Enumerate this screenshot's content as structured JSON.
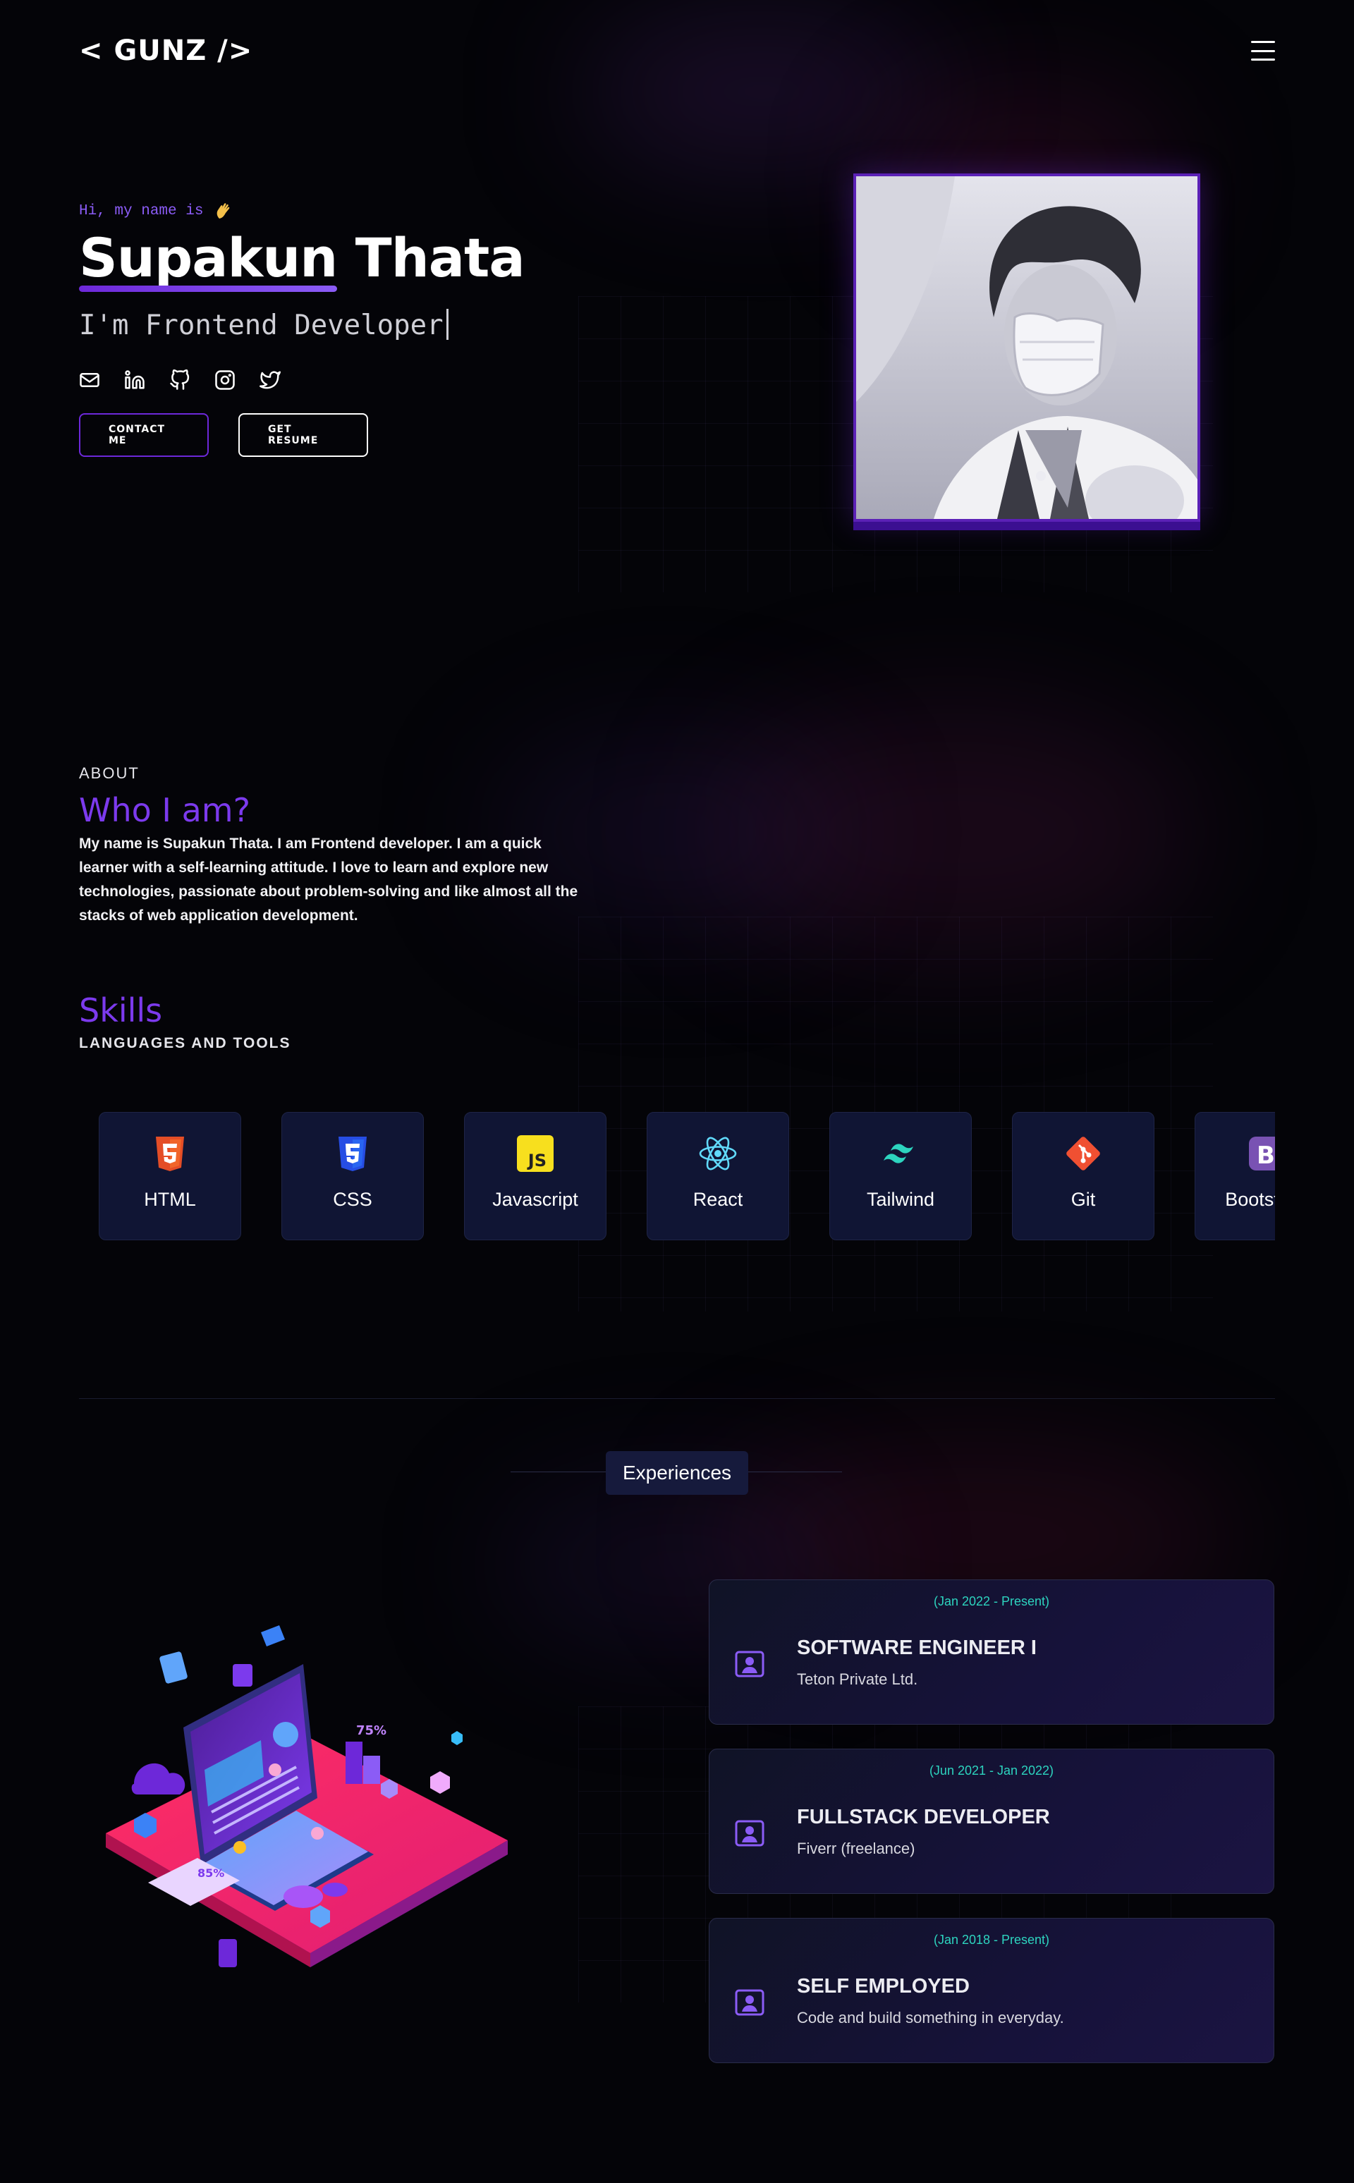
{
  "nav": {
    "logo": "< GUNZ />",
    "menu_icon": "menu-icon"
  },
  "hero": {
    "greeting": "Hi, my name is",
    "greeting_icon": "waving-hand-icon",
    "first_name": "Supakun",
    "last_name": "Thata",
    "role": "I'm Frontend Developer",
    "socials": [
      "mail-icon",
      "linkedin-icon",
      "github-icon",
      "instagram-icon",
      "twitter-icon"
    ],
    "contact_label": "CONTACT ME",
    "resume_label": "GET RESUME"
  },
  "about": {
    "eyebrow": "ABOUT",
    "heading": "Who I am?",
    "text": "My name is Supakun Thata. I am Frontend developer. I am a quick learner with a self-learning attitude. I love to learn and explore new technologies, passionate about problem-solving and like almost all the stacks of web application development."
  },
  "skills": {
    "heading": "Skills",
    "subheading": "LANGUAGES AND TOOLS",
    "items": [
      {
        "label": "HTML",
        "icon": "html5-icon",
        "color": "#e44d26"
      },
      {
        "label": "CSS",
        "icon": "css3-icon",
        "color": "#264de4"
      },
      {
        "label": "Javascript",
        "icon": "javascript-icon",
        "color": "#f7df1e"
      },
      {
        "label": "React",
        "icon": "react-icon",
        "color": "#61dafb"
      },
      {
        "label": "Tailwind",
        "icon": "tailwind-icon",
        "color": "#38bdf8"
      },
      {
        "label": "Git",
        "icon": "git-icon",
        "color": "#f05032"
      },
      {
        "label": "Bootstrap",
        "icon": "bootstrap-icon",
        "color": "#7952b3"
      }
    ]
  },
  "experiences": {
    "tab_label": "Experiences",
    "jobs": [
      {
        "date": "(Jan 2022 - Present)",
        "title": "SOFTWARE ENGINEER I",
        "company": "Teton Private Ltd."
      },
      {
        "date": "(Jun 2021 - Jan 2022)",
        "title": "FULLSTACK DEVELOPER",
        "company": "Fiverr (freelance)"
      },
      {
        "date": "(Jan 2018 - Present)",
        "title": "SELF EMPLOYED",
        "company": "Code and build something in everyday."
      }
    ]
  },
  "colors": {
    "accent": "#7c3aed",
    "teal": "#2dd4bf",
    "card_bg": "#101534"
  }
}
